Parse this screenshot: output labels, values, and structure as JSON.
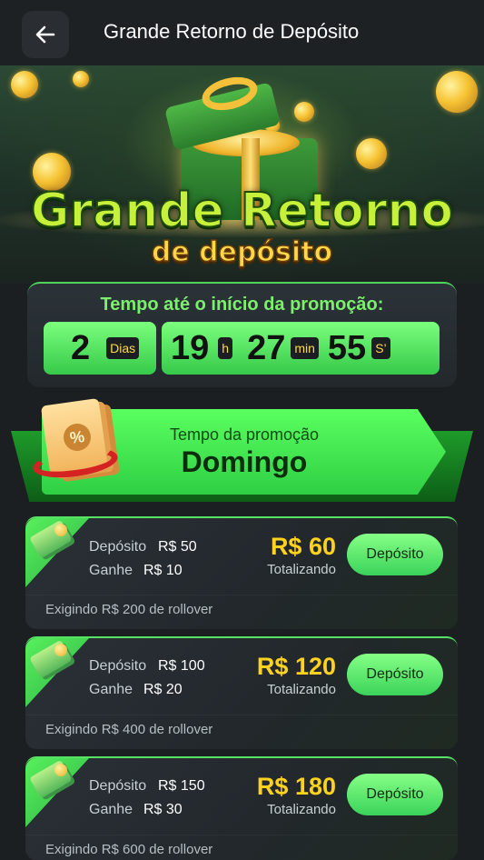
{
  "header": {
    "title": "Grande Retorno de Depósito",
    "back_icon": "arrow-left-icon"
  },
  "banner": {
    "title": "Grande Retorno",
    "subtitle": "de depósito"
  },
  "countdown": {
    "label": "Tempo até o início da promoção:",
    "days": "2",
    "days_unit": "Dias",
    "hours": "19",
    "hours_unit": "h",
    "minutes": "27",
    "minutes_unit": "min",
    "seconds": "55",
    "seconds_unit": "S’"
  },
  "promo": {
    "label": "Tempo da promoção",
    "day": "Domingo",
    "coupon_symbol": "%"
  },
  "offers": [
    {
      "deposit_label": "Depósito",
      "deposit_value": "R$ 50",
      "win_label": "Ganhe",
      "win_value": "R$ 10",
      "total": "R$ 60",
      "total_label": "Totalizando",
      "button": "Depósito",
      "rollover": "Exigindo R$ 200 de rollover"
    },
    {
      "deposit_label": "Depósito",
      "deposit_value": "R$ 100",
      "win_label": "Ganhe",
      "win_value": "R$ 20",
      "total": "R$ 120",
      "total_label": "Totalizando",
      "button": "Depósito",
      "rollover": "Exigindo R$ 400 de rollover"
    },
    {
      "deposit_label": "Depósito",
      "deposit_value": "R$ 150",
      "win_label": "Ganhe",
      "win_value": "R$ 30",
      "total": "R$ 180",
      "total_label": "Totalizando",
      "button": "Depósito",
      "rollover": "Exigindo R$ 600 de rollover"
    }
  ],
  "colors": {
    "accent_green": "#4fd65a",
    "gold": "#ffd21e",
    "background": "#1b1f22"
  }
}
